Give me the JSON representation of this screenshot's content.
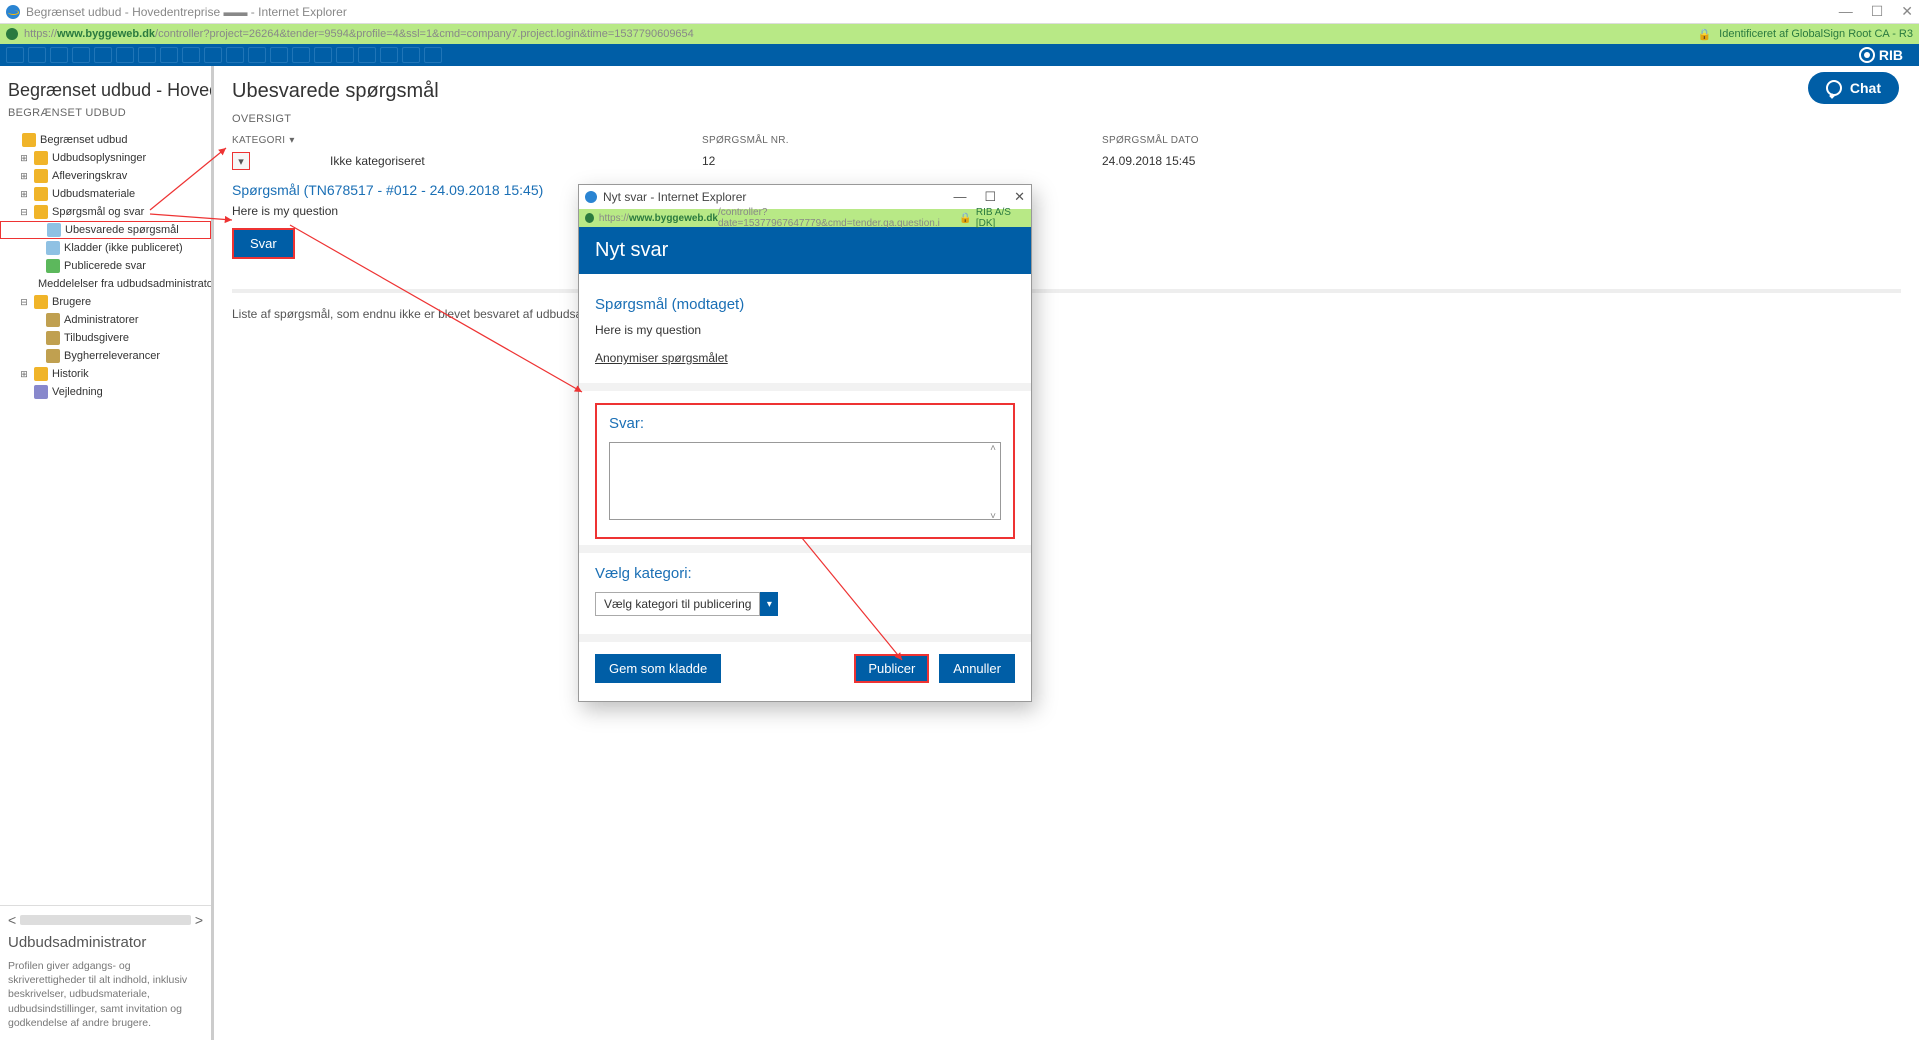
{
  "window": {
    "title": "Begrænset udbud - Hovedentreprise ▬▬ - Internet Explorer",
    "minimize": "—",
    "maximize": "☐",
    "close": "✕"
  },
  "addressbar": {
    "prefix": "https://",
    "domain": "www.byggeweb.dk",
    "rest": "/controller?project=26264&tender=9594&profile=4&ssl=1&cmd=company7.project.login&time=1537790609654",
    "lock_text": "Identificeret af GlobalSign Root CA - R3"
  },
  "brand": "RIB",
  "chat_label": "Chat",
  "sidebar": {
    "title": "Begrænset udbud - Hovedentreprise",
    "subtitle": "BEGRÆNSET UDBUD",
    "root": "Begrænset udbud",
    "items": {
      "udbudsoplysninger": "Udbudsoplysninger",
      "afleveringskrav": "Afleveringskrav",
      "udbudsmateriale": "Udbudsmateriale",
      "sporg": "Spørgsmål og svar",
      "ubesvarede": "Ubesvarede spørgsmål",
      "kladder": "Kladder (ikke publiceret)",
      "publicerede": "Publicerede svar",
      "meddelelser": "Meddelelser fra udbudsadministrator",
      "brugere": "Brugere",
      "admin": "Administratorer",
      "tilbud": "Tilbudsgivere",
      "bygherre": "Bygherreleverancer",
      "historik": "Historik",
      "vejledning": "Vejledning"
    },
    "role": "Udbudsadministrator",
    "desc": "Profilen giver adgangs- og skriverettigheder til alt indhold, inklusiv beskrivelser, udbudsmateriale, udbudsindstillinger, samt invitation og godkendelse af andre brugere."
  },
  "content": {
    "title": "Ubesvarede spørgsmål",
    "oversigt": "OVERSIGT",
    "cols": {
      "kategori": "KATEGORI",
      "nr": "SPØRGSMÅL NR.",
      "dato": "SPØRGSMÅL DATO"
    },
    "row": {
      "kategori": "Ikke kategoriseret",
      "nr": "12",
      "dato": "24.09.2018 15:45"
    },
    "question_title": "Spørgsmål (TN678517 - #012 - 24.09.2018 15:45)",
    "question_text": "Here is my question",
    "svar_btn": "Svar",
    "list_note": "Liste af spørgsmål, som endnu ikke er blevet besvaret af udbudsadministrator. A"
  },
  "popup": {
    "title": "Nyt svar - Internet Explorer",
    "addr_prefix": "https://",
    "addr_domain": "www.byggeweb.dk",
    "addr_rest": "/controller?date=15377967647779&cmd=tender.qa.question.i",
    "addr_right": "RIB A/S [DK]",
    "header": "Nyt svar",
    "q_head": "Spørgsmål (modtaget)",
    "q_text": "Here is my question",
    "anon": "Anonymiser spørgsmålet",
    "svar_head": "Svar:",
    "kat_head": "Vælg kategori:",
    "kat_select": "Vælg kategori til publicering",
    "btn_draft": "Gem som kladde",
    "btn_pub": "Publicer",
    "btn_cancel": "Annuller"
  }
}
